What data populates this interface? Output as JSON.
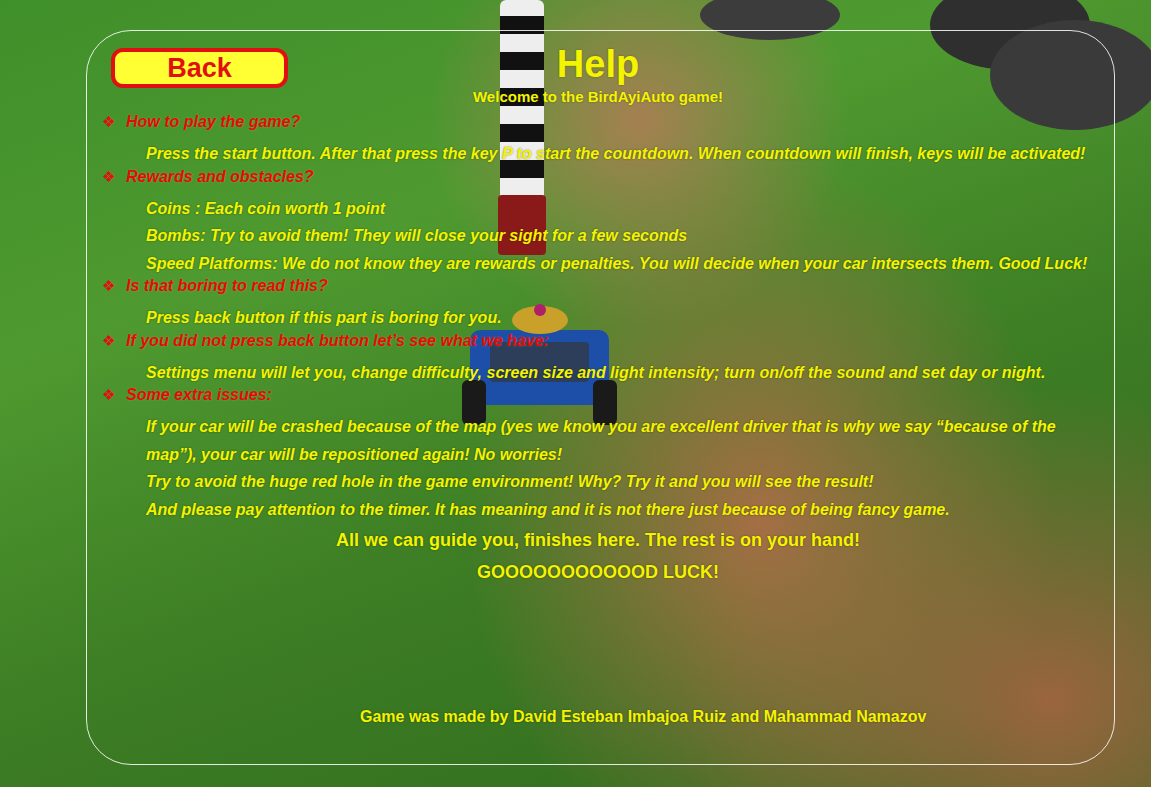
{
  "back_button": "Back",
  "title": "Help",
  "subtitle": "Welcome to the BirdAyiAuto game!",
  "sections": [
    {
      "bullet": "❖",
      "heading": "How to play the game?",
      "lines": [
        "Press the start button. After that press the key P to start the countdown. When countdown will finish, keys will be activated!"
      ]
    },
    {
      "bullet": "❖",
      "heading": "Rewards and obstacles?",
      "lines": [
        "Coins : Each coin worth 1 point",
        "Bombs: Try to avoid them! They will close your sight for a few seconds",
        "Speed Platforms: We do not know they are rewards or penalties. You will decide when your car intersects them. Good Luck!"
      ]
    },
    {
      "bullet": "❖",
      "heading": "Is that boring to read this?",
      "lines": [
        "Press back button if this part is boring for you."
      ]
    },
    {
      "bullet": "❖",
      "heading": "If you did not press back button let’s see what we have:",
      "lines": [
        "Settings menu will let you, change difficulty, screen size and light intensity; turn on/off the sound and set day or night."
      ]
    },
    {
      "bullet": "❖",
      "heading": "Some extra issues:",
      "lines": [
        "If your car will be crashed because of the map (yes we know you are excellent driver that is why we say “because of the map”), your car will be repositioned again! No worries!",
        "Try to avoid the huge red hole in the game environment! Why? Try it and you will see the result!",
        "And please pay attention to the timer. It has meaning and it is not there just because of being fancy game."
      ]
    }
  ],
  "closing": [
    "All we can guide you, finishes here. The rest is on your hand!",
    "GOOOOOOOOOOOD LUCK!"
  ],
  "credits": "Game was made by David Esteban Imbajoa Ruiz and Mahammad Namazov"
}
